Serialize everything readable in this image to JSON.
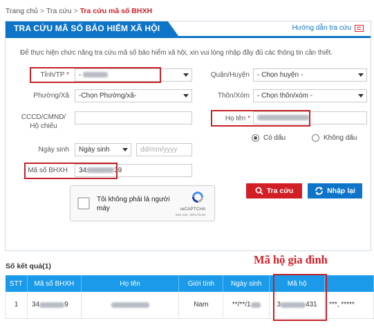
{
  "breadcrumb": {
    "home": "Trang chủ",
    "sep1": ">",
    "lookup": "Tra cứu",
    "sep2": ">",
    "current": "Tra cứu mã số BHXH"
  },
  "panel": {
    "title": "TRA CỨU MÃ SỐ BẢO HIỂM XÃ HỘI",
    "guide_link": "Hướng dẫn tra cứu",
    "guide_icon": "book-icon",
    "instruction": "Để thực hiện chức năng tra cứu mã số bảo hiểm xã hội, xin vui lòng nhập đầy đủ các thông tin cần thiết."
  },
  "form": {
    "province_label": "Tỉnh/TP",
    "required_mark": "*",
    "province_value": "-",
    "district_label": "Quận/Huyện",
    "district_value": "- Chọn huyện -",
    "ward_label": "Phường/Xã",
    "ward_value": "-Chọn Phường/xã-",
    "hamlet_label": "Thôn/Xóm",
    "hamlet_value": "- Chọn thôn/xóm -",
    "id_label_line1": "CCCD/CMND/",
    "id_label_line2": "Hộ chiếu",
    "id_value": "",
    "name_label": "Họ tên",
    "name_required": "*",
    "diacritics_on": "Có dấu",
    "diacritics_off": "Không dấu",
    "dob_label": "Ngày sinh",
    "dob_type": "Ngày sinh",
    "dob_placeholder": "dd/mm/yyyy",
    "bhxh_label": "Mã số BHXH",
    "bhxh_prefix": "34",
    "bhxh_suffix": "39"
  },
  "captcha": {
    "text": "Tôi không phải là người máy",
    "brand": "reCAPTCHA",
    "terms": "Bảo mật - Điều khoản"
  },
  "buttons": {
    "search": "Tra cứu",
    "reset": "Nhập lại"
  },
  "annotation": "Mã hộ gia đình",
  "results": {
    "count_label": "Số kết quả(1)",
    "headers": [
      "STT",
      "Mã số BHXH",
      "Họ tên",
      "Giới tính",
      "Ngày sinh",
      "Mã hộ"
    ],
    "row": {
      "stt": "1",
      "bhxh_prefix": "34",
      "bhxh_suffix": "9",
      "gender": "Nam",
      "dob_prefix": "**/**/1",
      "household_prefix": "3",
      "household_suffix": "431",
      "extra": "***, *****"
    }
  },
  "colors": {
    "brand_blue": "#0d74c7",
    "table_header": "#1a9ae8",
    "accent_red": "#d21f26",
    "highlight_box": "#c62026"
  }
}
